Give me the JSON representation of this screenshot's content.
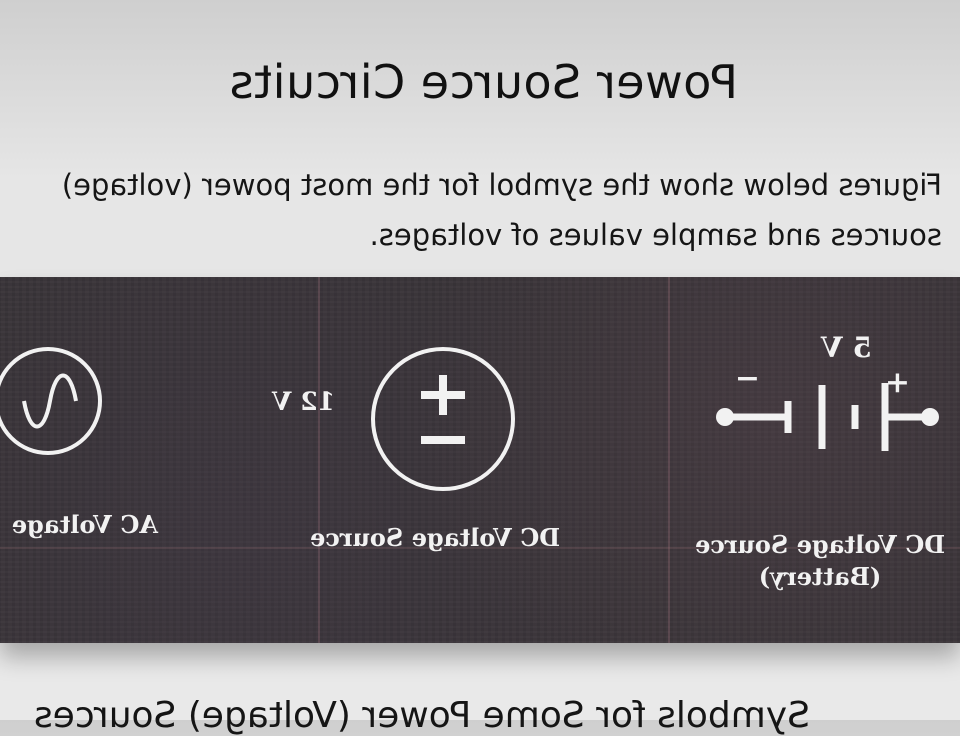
{
  "slide": {
    "title": "Power Source Circuits",
    "intro_line1": "Figures below show the symbol for the most power (voltage)",
    "intro_line2": "sources and sample values of voltages.",
    "footer": "Symbols for Some Power (Voltage) Sources"
  },
  "symbols": {
    "battery": {
      "value": "5 V",
      "plus": "+",
      "minus": "−",
      "caption_line1": "DC Voltage Source",
      "caption_line2": "(Battery)"
    },
    "dc": {
      "value": "12 V",
      "plus": "+",
      "caption": "DC Voltage Source"
    },
    "ac": {
      "caption": "AC Voltage"
    }
  },
  "colors": {
    "panel": "#3a3539",
    "symbol": "#f2f2f2",
    "text": "#111111"
  }
}
